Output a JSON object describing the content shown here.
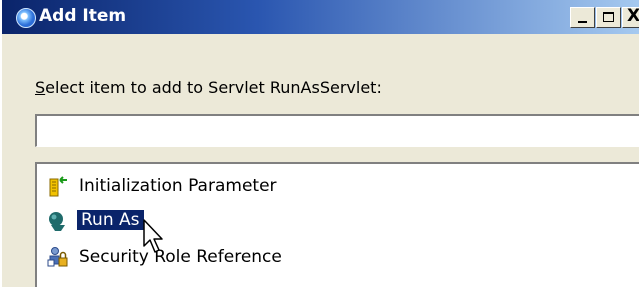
{
  "window": {
    "title": "Add Item",
    "controls": {
      "minimize": "_",
      "maximize": "□",
      "close": "X"
    }
  },
  "dialog": {
    "prompt_mnemonic": "S",
    "prompt_rest": "elect item to add to Servlet RunAsServlet:",
    "filter_value": ""
  },
  "items": [
    {
      "label": "Initialization Parameter",
      "icon": "init-parameter-icon",
      "selected": false
    },
    {
      "label": "Run As",
      "icon": "run-as-icon",
      "selected": true
    },
    {
      "label": "Security Role Reference",
      "icon": "security-role-icon",
      "selected": false
    }
  ],
  "colors": {
    "title_gradient_start": "#0a246a",
    "title_gradient_end": "#a6caf0",
    "selection": "#0a246a",
    "dialog_bg": "#ece9d8"
  }
}
